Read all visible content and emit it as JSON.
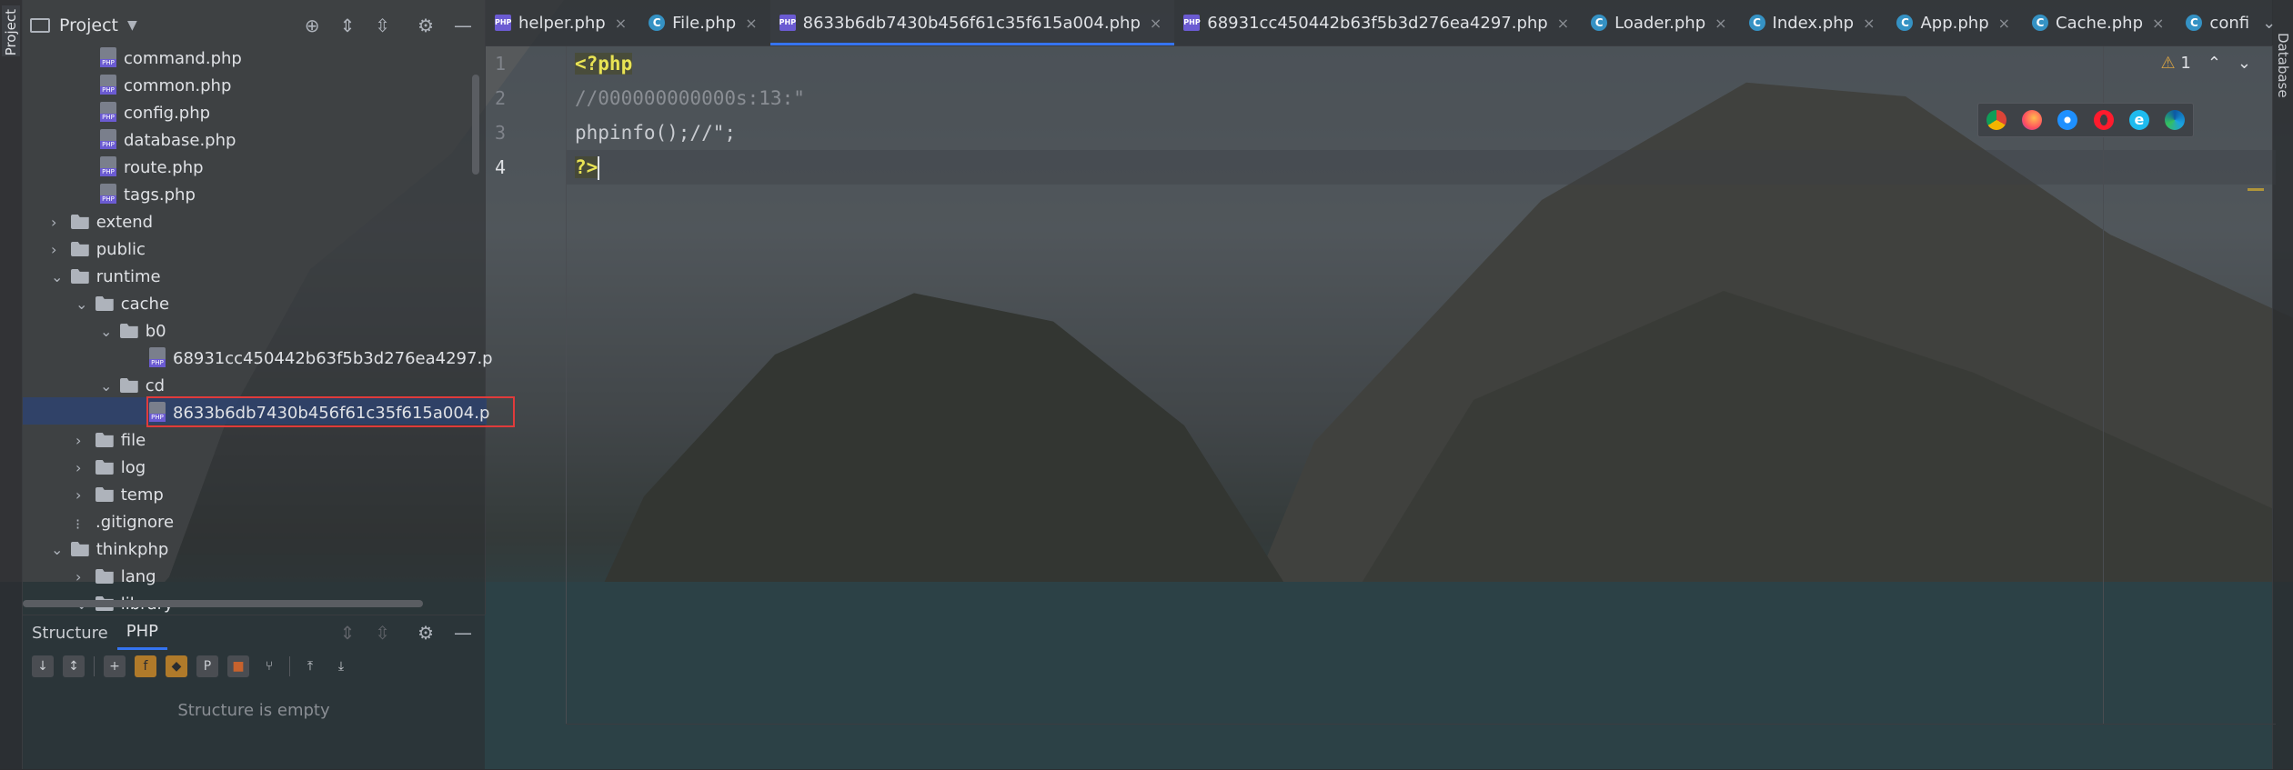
{
  "window": {
    "left_stripe_label": "Project",
    "right_stripe_label": "Database"
  },
  "project_panel": {
    "title": "Project",
    "tree": [
      {
        "label": "command.php",
        "type": "php",
        "indent": 3
      },
      {
        "label": "common.php",
        "type": "php",
        "indent": 3
      },
      {
        "label": "config.php",
        "type": "php",
        "indent": 3
      },
      {
        "label": "database.php",
        "type": "php",
        "indent": 3
      },
      {
        "label": "route.php",
        "type": "php",
        "indent": 3
      },
      {
        "label": "tags.php",
        "type": "php",
        "indent": 3
      },
      {
        "label": "extend",
        "type": "folder",
        "indent": 1,
        "expanded": false
      },
      {
        "label": "public",
        "type": "folder",
        "indent": 1,
        "expanded": false
      },
      {
        "label": "runtime",
        "type": "folder",
        "indent": 1,
        "expanded": true
      },
      {
        "label": "cache",
        "type": "folder",
        "indent": 2,
        "expanded": true
      },
      {
        "label": "b0",
        "type": "folder",
        "indent": 3,
        "expanded": true
      },
      {
        "label": "68931cc450442b63f5b3d276ea4297.p",
        "type": "php",
        "indent": 5
      },
      {
        "label": "cd",
        "type": "folder",
        "indent": 3,
        "expanded": true
      },
      {
        "label": "8633b6db7430b456f61c35f615a004.p",
        "type": "php",
        "indent": 5,
        "selected": true
      },
      {
        "label": "file",
        "type": "folder",
        "indent": 2,
        "expanded": false
      },
      {
        "label": "log",
        "type": "folder",
        "indent": 2,
        "expanded": false
      },
      {
        "label": "temp",
        "type": "folder",
        "indent": 2,
        "expanded": false
      },
      {
        "label": ".gitignore",
        "type": "git",
        "indent": 2
      },
      {
        "label": "thinkphp",
        "type": "folder",
        "indent": 1,
        "expanded": true
      },
      {
        "label": "lang",
        "type": "folder",
        "indent": 2,
        "expanded": false
      },
      {
        "label": "library",
        "type": "folder",
        "indent": 2,
        "expanded": true
      }
    ]
  },
  "structure_panel": {
    "tab_structure": "Structure",
    "tab_php": "PHP",
    "empty_text": "Structure is empty"
  },
  "tabs": [
    {
      "label": "helper.php",
      "icon": "php-file-icon",
      "active": false
    },
    {
      "label": "File.php",
      "icon": "class-icon",
      "active": false
    },
    {
      "label": "8633b6db7430b456f61c35f615a004.php",
      "icon": "php-file-icon",
      "active": true
    },
    {
      "label": "68931cc450442b63f5b3d276ea4297.php",
      "icon": "php-file-icon",
      "active": false
    },
    {
      "label": "Loader.php",
      "icon": "class-icon",
      "active": false
    },
    {
      "label": "Index.php",
      "icon": "class-icon",
      "active": false
    },
    {
      "label": "App.php",
      "icon": "class-icon",
      "active": false
    },
    {
      "label": "Cache.php",
      "icon": "class-icon",
      "active": false
    },
    {
      "label": "confi",
      "icon": "class-icon",
      "active": false
    }
  ],
  "editor": {
    "lines": [
      {
        "num": "1",
        "text": "<?php"
      },
      {
        "num": "2",
        "text": "//000000000000s:13:\""
      },
      {
        "num": "3",
        "text": "phpinfo();//\";"
      },
      {
        "num": "4",
        "text": "?>"
      }
    ],
    "warning_count": "1"
  },
  "colors": {
    "accent": "#3574f0",
    "selection_outline": "#e03b3b",
    "php_tag": "#e9e354"
  }
}
